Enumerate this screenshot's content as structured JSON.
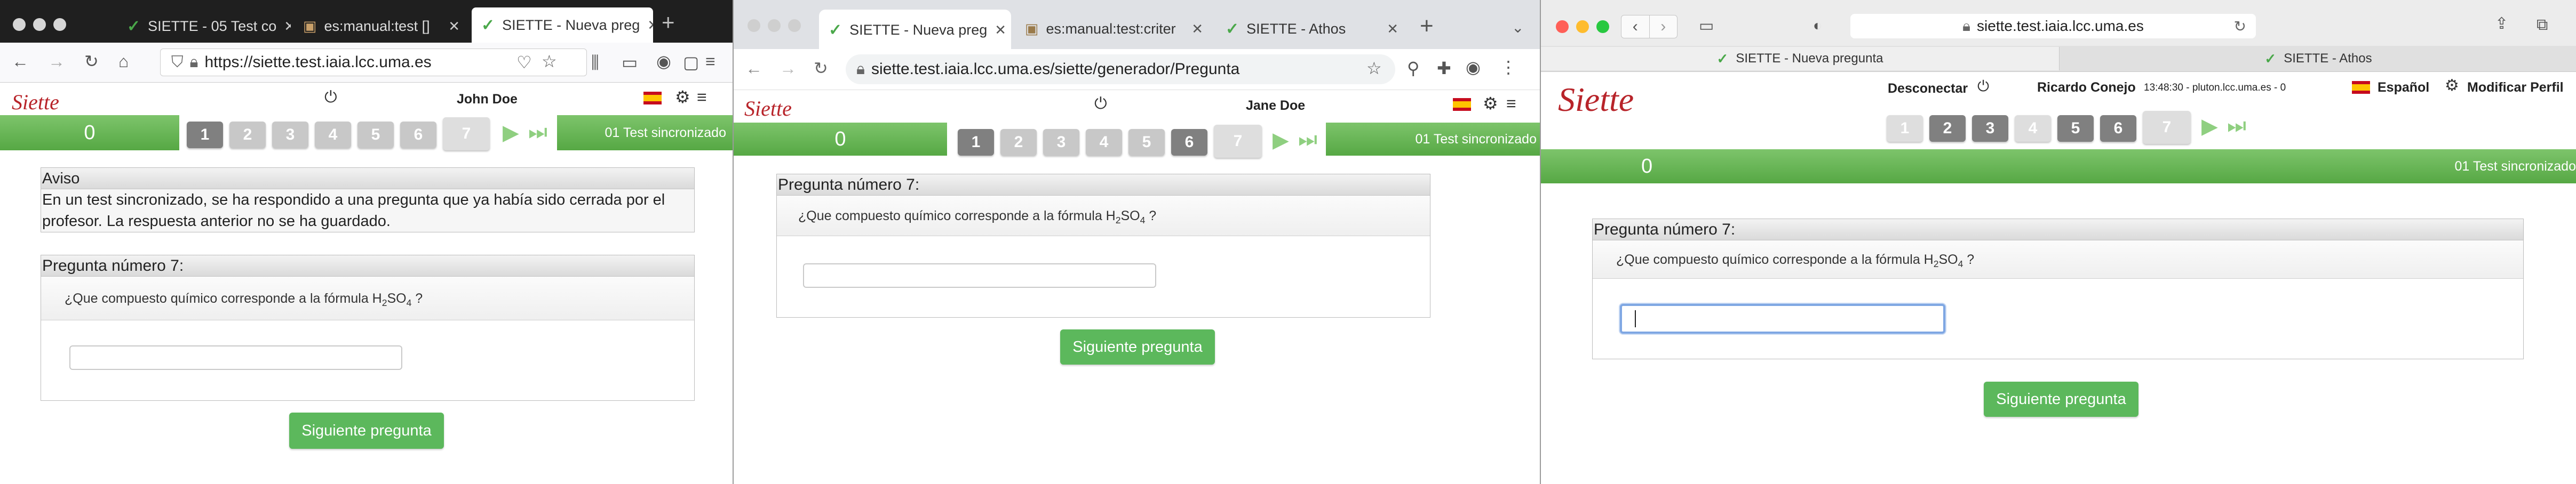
{
  "colors": {
    "accent_green": "#5cb85c",
    "brand_red": "#b8242a"
  },
  "window1": {
    "tabs": [
      "SIETTE - 05 Test co",
      "es:manual:test []",
      "SIETTE - Nueva preg"
    ],
    "new_tab": "+",
    "url": "https://siette.test.iaia.lcc.uma.es",
    "logo": "Siette",
    "user": "John Doe",
    "score": "0",
    "pages": [
      "1",
      "2",
      "3",
      "4",
      "5",
      "6",
      "7"
    ],
    "test_name": "01 Test sincronizado",
    "notice": {
      "title": "Aviso",
      "body": "En un test sincronizado, se ha respondido a una pregunta que ya había sido cerrada por el profesor. La respuesta anterior no se ha guardado."
    },
    "question": {
      "title": "Pregunta número 7:",
      "text_before": "¿Que compuesto químico corresponde a la fórmula H",
      "sub1": "2",
      "mid": "SO",
      "sub2": "4",
      "text_after": " ?"
    },
    "next_button": "Siguiente pregunta"
  },
  "window2": {
    "tabs": [
      "SIETTE - Nueva preg",
      "es:manual:test:criter",
      "SIETTE - Athos"
    ],
    "new_tab": "+",
    "url": "siette.test.iaia.lcc.uma.es/siette/generador/Pregunta",
    "logo": "Siette",
    "user": "Jane Doe",
    "score": "0",
    "pages": [
      "1",
      "2",
      "3",
      "4",
      "5",
      "6",
      "7"
    ],
    "test_name": "01 Test sincronizado",
    "question": {
      "title": "Pregunta número 7:",
      "text_before": "¿Que compuesto químico corresponde a la fórmula H",
      "sub1": "2",
      "mid": "SO",
      "sub2": "4",
      "text_after": " ?"
    },
    "next_button": "Siguiente pregunta"
  },
  "window3": {
    "url": "siette.test.iaia.lcc.uma.es",
    "tabs": [
      "SIETTE - Nueva pregunta",
      "SIETTE - Athos"
    ],
    "logo": "Siette",
    "disconnect": "Desconectar",
    "user": "Ricardo Conejo",
    "session_info": "13:48:30 - pluton.lcc.uma.es - 0",
    "language": "Español",
    "modify_profile": "Modificar Perfil",
    "pages": [
      "1",
      "2",
      "3",
      "4",
      "5",
      "6",
      "7"
    ],
    "score": "0",
    "test_name": "01 Test sincronizado",
    "question": {
      "title": "Pregunta número 7:",
      "text_before": "¿Que compuesto químico corresponde a la fórmula H",
      "sub1": "2",
      "mid": "SO",
      "sub2": "4",
      "text_after": " ?"
    },
    "next_button": "Siguiente pregunta"
  }
}
